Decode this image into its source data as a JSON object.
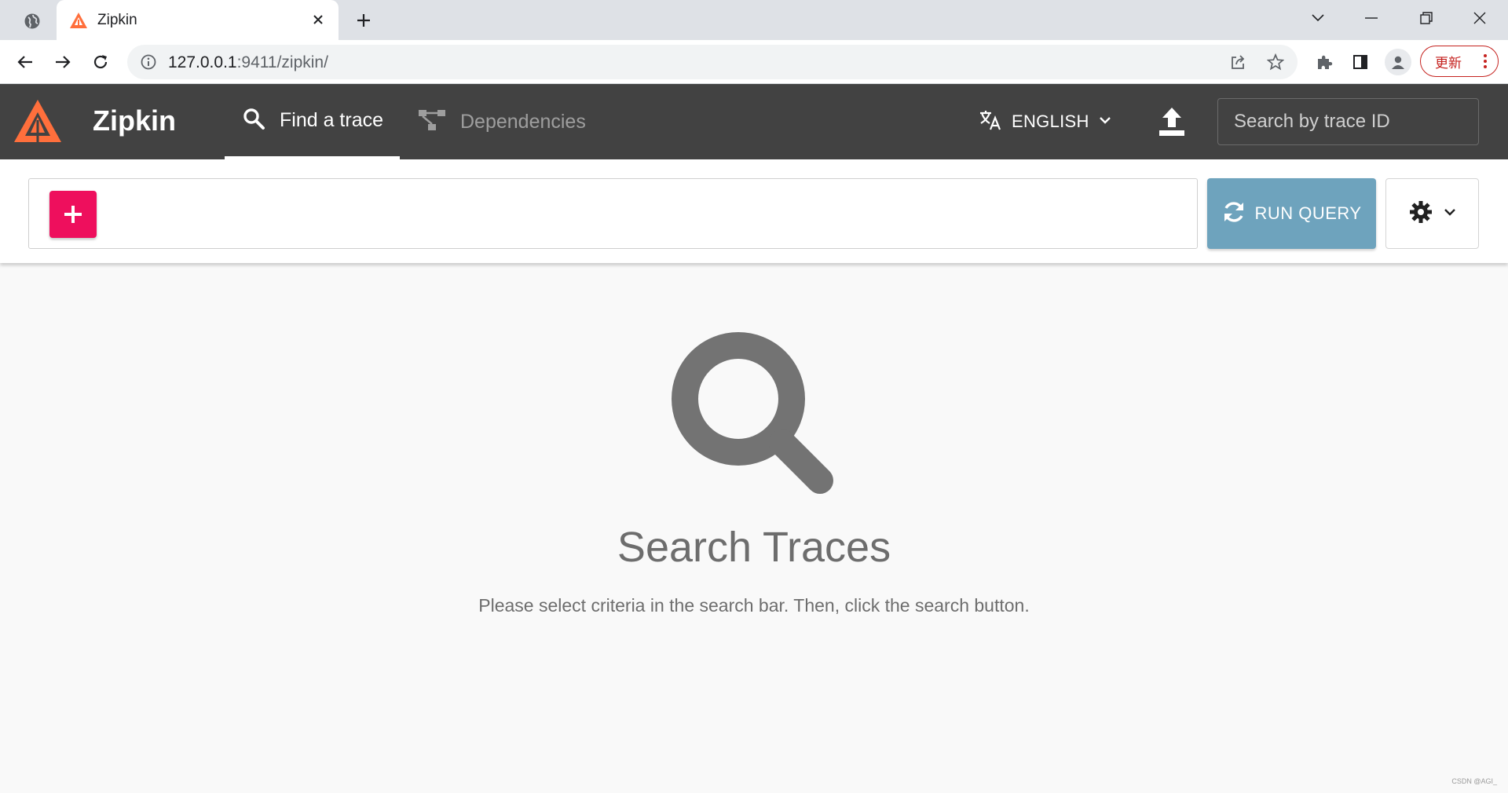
{
  "browser": {
    "tab": {
      "title": "Zipkin",
      "close_icon": "close-icon"
    },
    "new_tab_icon": "plus-icon",
    "address_bar": {
      "host": "127.0.0.1",
      "path": ":9411/zipkin/"
    },
    "update_button": {
      "label": "更新"
    }
  },
  "header": {
    "brand": "Zipkin",
    "nav": {
      "find_trace": "Find a trace",
      "dependencies": "Dependencies"
    },
    "language": "ENGLISH",
    "trace_search": {
      "placeholder": "Search by trace ID"
    }
  },
  "search": {
    "add_button_label": "+",
    "run_query_label": "RUN QUERY"
  },
  "empty_state": {
    "title": "Search Traces",
    "description": "Please select criteria in the search bar. Then, click the search button."
  },
  "watermark": "CSDN @AGI_",
  "colors": {
    "header_bg": "#424242",
    "brand_orange": "#ff6f3c",
    "add_button": "#ee0f5d",
    "run_query": "#6ea3bd",
    "page_bg": "#f9f9f9"
  }
}
